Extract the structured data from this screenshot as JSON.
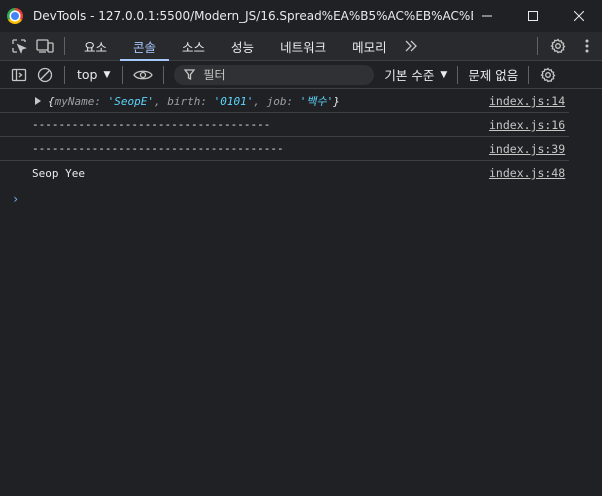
{
  "window": {
    "title": "DevTools - 127.0.0.1:5500/Modern_JS/16.Spread%EA%B5%AC%EB%AC%B8%2..."
  },
  "tabs": [
    {
      "label": "요소"
    },
    {
      "label": "콘솔"
    },
    {
      "label": "소스"
    },
    {
      "label": "성능"
    },
    {
      "label": "네트워크"
    },
    {
      "label": "메모리"
    }
  ],
  "toolbar": {
    "context": "top",
    "filter_placeholder": "필터",
    "levels": "기본 수준",
    "issues": "문제 없음"
  },
  "console": {
    "messages": [
      {
        "object": {
          "open": "{",
          "k1": "myName",
          "v1": "'SeopE'",
          "k2": "birth",
          "v2": "'0101'",
          "k3": "job",
          "v3": "'백수'",
          "close": "}"
        },
        "source": "index.js:14"
      },
      {
        "text": "------------------------------------",
        "source": "index.js:16"
      },
      {
        "text": "--------------------------------------",
        "source": "index.js:39"
      },
      {
        "text": "Seop Yee",
        "source": "index.js:48"
      }
    ],
    "prompt": "›"
  },
  "colors": {
    "accent": "#a8c7fa",
    "string": "#5cd5fb",
    "background": "#202124"
  }
}
